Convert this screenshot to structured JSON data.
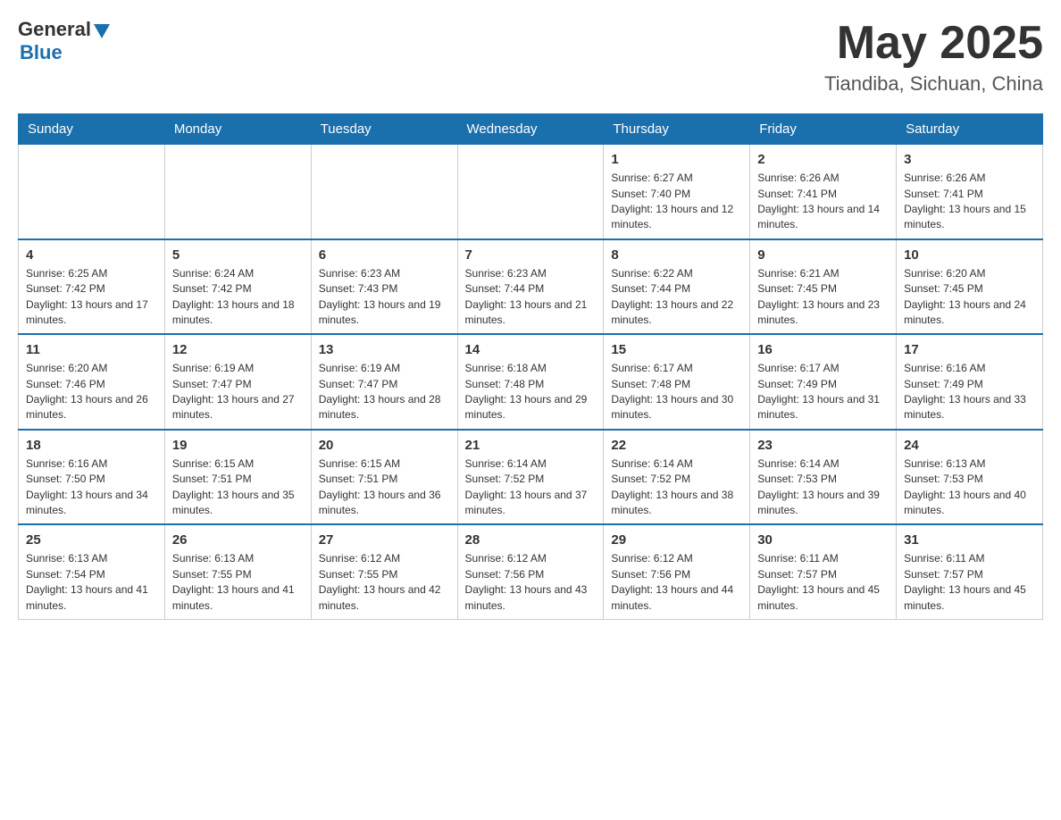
{
  "header": {
    "logo": {
      "text_general": "General",
      "text_blue": "Blue"
    },
    "title": "May 2025",
    "location": "Tiandiba, Sichuan, China"
  },
  "days_of_week": [
    "Sunday",
    "Monday",
    "Tuesday",
    "Wednesday",
    "Thursday",
    "Friday",
    "Saturday"
  ],
  "weeks": [
    [
      {
        "day": "",
        "info": ""
      },
      {
        "day": "",
        "info": ""
      },
      {
        "day": "",
        "info": ""
      },
      {
        "day": "",
        "info": ""
      },
      {
        "day": "1",
        "info": "Sunrise: 6:27 AM\nSunset: 7:40 PM\nDaylight: 13 hours and 12 minutes."
      },
      {
        "day": "2",
        "info": "Sunrise: 6:26 AM\nSunset: 7:41 PM\nDaylight: 13 hours and 14 minutes."
      },
      {
        "day": "3",
        "info": "Sunrise: 6:26 AM\nSunset: 7:41 PM\nDaylight: 13 hours and 15 minutes."
      }
    ],
    [
      {
        "day": "4",
        "info": "Sunrise: 6:25 AM\nSunset: 7:42 PM\nDaylight: 13 hours and 17 minutes."
      },
      {
        "day": "5",
        "info": "Sunrise: 6:24 AM\nSunset: 7:42 PM\nDaylight: 13 hours and 18 minutes."
      },
      {
        "day": "6",
        "info": "Sunrise: 6:23 AM\nSunset: 7:43 PM\nDaylight: 13 hours and 19 minutes."
      },
      {
        "day": "7",
        "info": "Sunrise: 6:23 AM\nSunset: 7:44 PM\nDaylight: 13 hours and 21 minutes."
      },
      {
        "day": "8",
        "info": "Sunrise: 6:22 AM\nSunset: 7:44 PM\nDaylight: 13 hours and 22 minutes."
      },
      {
        "day": "9",
        "info": "Sunrise: 6:21 AM\nSunset: 7:45 PM\nDaylight: 13 hours and 23 minutes."
      },
      {
        "day": "10",
        "info": "Sunrise: 6:20 AM\nSunset: 7:45 PM\nDaylight: 13 hours and 24 minutes."
      }
    ],
    [
      {
        "day": "11",
        "info": "Sunrise: 6:20 AM\nSunset: 7:46 PM\nDaylight: 13 hours and 26 minutes."
      },
      {
        "day": "12",
        "info": "Sunrise: 6:19 AM\nSunset: 7:47 PM\nDaylight: 13 hours and 27 minutes."
      },
      {
        "day": "13",
        "info": "Sunrise: 6:19 AM\nSunset: 7:47 PM\nDaylight: 13 hours and 28 minutes."
      },
      {
        "day": "14",
        "info": "Sunrise: 6:18 AM\nSunset: 7:48 PM\nDaylight: 13 hours and 29 minutes."
      },
      {
        "day": "15",
        "info": "Sunrise: 6:17 AM\nSunset: 7:48 PM\nDaylight: 13 hours and 30 minutes."
      },
      {
        "day": "16",
        "info": "Sunrise: 6:17 AM\nSunset: 7:49 PM\nDaylight: 13 hours and 31 minutes."
      },
      {
        "day": "17",
        "info": "Sunrise: 6:16 AM\nSunset: 7:49 PM\nDaylight: 13 hours and 33 minutes."
      }
    ],
    [
      {
        "day": "18",
        "info": "Sunrise: 6:16 AM\nSunset: 7:50 PM\nDaylight: 13 hours and 34 minutes."
      },
      {
        "day": "19",
        "info": "Sunrise: 6:15 AM\nSunset: 7:51 PM\nDaylight: 13 hours and 35 minutes."
      },
      {
        "day": "20",
        "info": "Sunrise: 6:15 AM\nSunset: 7:51 PM\nDaylight: 13 hours and 36 minutes."
      },
      {
        "day": "21",
        "info": "Sunrise: 6:14 AM\nSunset: 7:52 PM\nDaylight: 13 hours and 37 minutes."
      },
      {
        "day": "22",
        "info": "Sunrise: 6:14 AM\nSunset: 7:52 PM\nDaylight: 13 hours and 38 minutes."
      },
      {
        "day": "23",
        "info": "Sunrise: 6:14 AM\nSunset: 7:53 PM\nDaylight: 13 hours and 39 minutes."
      },
      {
        "day": "24",
        "info": "Sunrise: 6:13 AM\nSunset: 7:53 PM\nDaylight: 13 hours and 40 minutes."
      }
    ],
    [
      {
        "day": "25",
        "info": "Sunrise: 6:13 AM\nSunset: 7:54 PM\nDaylight: 13 hours and 41 minutes."
      },
      {
        "day": "26",
        "info": "Sunrise: 6:13 AM\nSunset: 7:55 PM\nDaylight: 13 hours and 41 minutes."
      },
      {
        "day": "27",
        "info": "Sunrise: 6:12 AM\nSunset: 7:55 PM\nDaylight: 13 hours and 42 minutes."
      },
      {
        "day": "28",
        "info": "Sunrise: 6:12 AM\nSunset: 7:56 PM\nDaylight: 13 hours and 43 minutes."
      },
      {
        "day": "29",
        "info": "Sunrise: 6:12 AM\nSunset: 7:56 PM\nDaylight: 13 hours and 44 minutes."
      },
      {
        "day": "30",
        "info": "Sunrise: 6:11 AM\nSunset: 7:57 PM\nDaylight: 13 hours and 45 minutes."
      },
      {
        "day": "31",
        "info": "Sunrise: 6:11 AM\nSunset: 7:57 PM\nDaylight: 13 hours and 45 minutes."
      }
    ]
  ]
}
